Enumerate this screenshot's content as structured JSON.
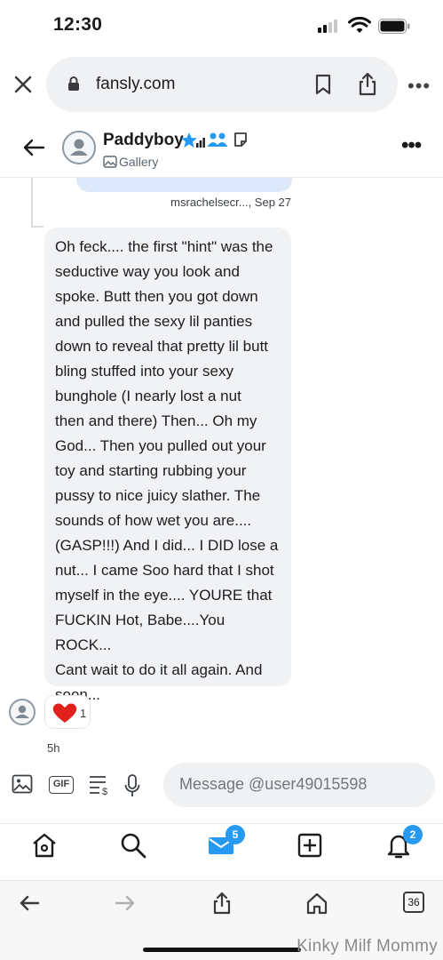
{
  "status_bar": {
    "time": "12:30"
  },
  "browser": {
    "url": "fansly.com",
    "tab_count": "36"
  },
  "chat_header": {
    "name": "Paddyboy",
    "subtitle": "Gallery"
  },
  "previous_message": {
    "meta": "msrachelsecr..., Sep 27"
  },
  "message": {
    "text": "Oh feck.... the first \"hint\" was the\nseductive way you look and\nspoke. Butt then you got down\nand pulled the sexy lil panties\ndown to reveal that pretty lil butt\nbling stuffed into your sexy\nbunghole (I nearly lost a nut\nthen and there) Then... Oh my\nGod... Then you pulled out your\ntoy and starting rubbing your\npussy to nice juicy slather. The\nsounds of how wet you are....\n(GASP!!!)  And I did... I DID lose a\nnut... I came Soo hard that I shot\nmyself in the eye.... YOURE that\nFUCKIN Hot, Babe....You ROCK...\nCant wait to do it all again. And\nsoon...",
    "reaction_count": "1",
    "time_ago": "5h"
  },
  "compose": {
    "placeholder": "Message @user49015598",
    "gif_label": "GIF"
  },
  "app_nav": {
    "messages_badge": "5",
    "notifications_badge": "2"
  },
  "watermark": "Kinky Milf Mommy",
  "colors": {
    "accent": "#2699f0",
    "bubble": "#f1f2f4",
    "heart": "#e0201b"
  }
}
